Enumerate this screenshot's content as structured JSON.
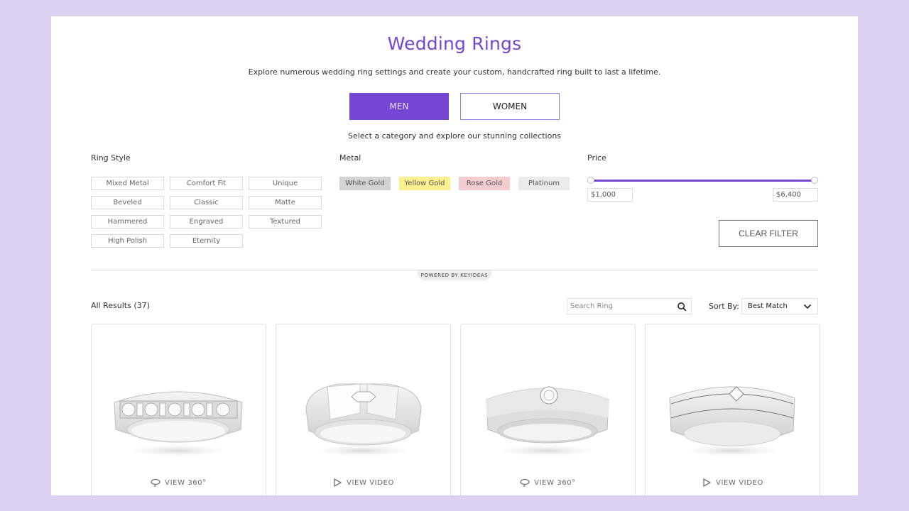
{
  "header": {
    "title": "Wedding Rings",
    "subtitle": "Explore numerous wedding ring settings and create your custom, handcrafted ring built to last a lifetime.",
    "category_note": "Select a category and explore our stunning collections"
  },
  "gender_tabs": [
    {
      "label": "MEN",
      "active": true
    },
    {
      "label": "WOMEN",
      "active": false
    }
  ],
  "filters": {
    "ring_style": {
      "label": "Ring Style",
      "options": [
        "Mixed Metal",
        "Comfort Fit",
        "Unique",
        "Beveled",
        "Classic",
        "Matte",
        "Hammered",
        "Engraved",
        "Textured",
        "High Polish",
        "Eternity"
      ]
    },
    "metal": {
      "label": "Metal",
      "options": [
        {
          "label": "White Gold",
          "color": "#d3d3d3"
        },
        {
          "label": "Yellow Gold",
          "color": "#fbef8f"
        },
        {
          "label": "Rose Gold",
          "color": "#f4cccd"
        },
        {
          "label": "Platinum",
          "color": "#ebebeb"
        }
      ]
    },
    "price": {
      "label": "Price",
      "min_value": "$1,000",
      "max_value": "$6,400",
      "range_low_fraction": 0,
      "range_high_fraction": 1
    },
    "clear_label": "CLEAR FILTER"
  },
  "powered_by": "POWERED BY KEYIDEAS",
  "results": {
    "label": "All Results (37)",
    "search_placeholder": "Search Ring",
    "sort_label": "Sort By:",
    "sort_value": "Best Match"
  },
  "products": [
    {
      "media_label": "VIEW 360°",
      "media_icon": "rotate-360-icon"
    },
    {
      "media_label": "VIEW VIDEO",
      "media_icon": "play-icon"
    },
    {
      "media_label": "VIEW 360°",
      "media_icon": "rotate-360-icon"
    },
    {
      "media_label": "VIEW VIDEO",
      "media_icon": "play-icon"
    }
  ],
  "colors": {
    "accent": "#7646d5",
    "page_background": "#dcd2f0"
  }
}
